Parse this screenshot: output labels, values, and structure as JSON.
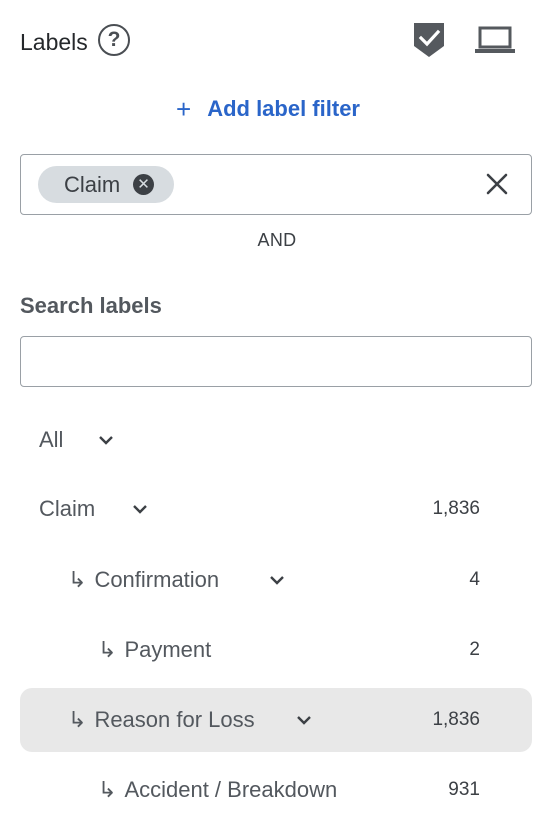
{
  "header": {
    "title": "Labels",
    "help_icon": "?",
    "icons": [
      "help-circle-icon",
      "shield-check-icon",
      "laptop-icon"
    ]
  },
  "add_filter": {
    "plus": "+",
    "label": "Add label filter"
  },
  "filter": {
    "chip_label": "Claim",
    "chip_remove": "✕",
    "operator": "AND"
  },
  "search": {
    "heading": "Search labels",
    "placeholder": "",
    "value": ""
  },
  "tree": [
    {
      "label": "All",
      "count": "",
      "arrow": "",
      "expandable": true
    },
    {
      "label": "Claim",
      "count": "1,836",
      "arrow": "",
      "expandable": true
    },
    {
      "label": "Confirmation",
      "count": "4",
      "arrow": "↳",
      "expandable": true
    },
    {
      "label": "Payment",
      "count": "2",
      "arrow": "↳",
      "expandable": false
    },
    {
      "label": "Reason for Loss",
      "count": "1,836",
      "arrow": "↳",
      "expandable": true,
      "selected": true
    },
    {
      "label": "Accident / Breakdown",
      "count": "931",
      "arrow": "↳",
      "expandable": false
    }
  ],
  "colors": {
    "accent": "#2a65c9",
    "selected_bg": "#e8e8e8",
    "chip_bg": "#d7dce0"
  }
}
